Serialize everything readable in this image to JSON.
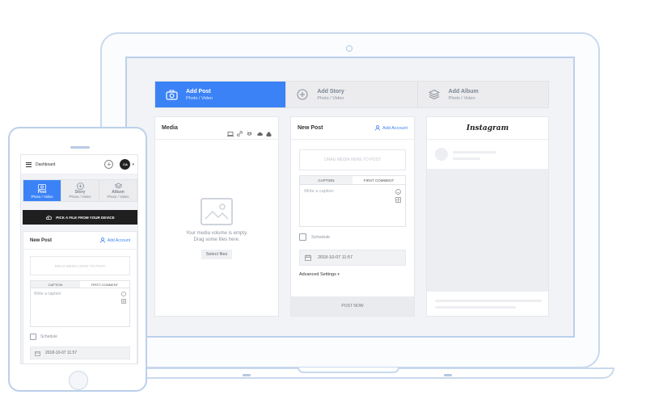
{
  "tabs": [
    {
      "title": "Add Post",
      "subtitle": "Photo / Video",
      "icon": "camera-icon"
    },
    {
      "title": "Add Story",
      "subtitle": "Photo / Video",
      "icon": "plus-circle-icon"
    },
    {
      "title": "Add Album",
      "subtitle": "Photo / Video",
      "icon": "layers-icon"
    }
  ],
  "media": {
    "title": "Media",
    "empty_line1": "Your media volume is empty.",
    "empty_line2": "Drag some files here.",
    "select_label": "Select files"
  },
  "new_post": {
    "title": "New Post",
    "add_account": "Add Account",
    "drop_placeholder": "DRAG MEDIA HERE TO POST",
    "tab_caption": "CAPTION",
    "tab_first_comment": "FIRST COMMENT",
    "caption_placeholder": "Write a caption",
    "schedule_label": "Schedule",
    "date_value": "2018-10-07 11:57",
    "advanced_label": "Advanced Settings",
    "post_now": "POST NOW"
  },
  "preview": {
    "logo": "Instagram"
  },
  "phone": {
    "header_title": "Dashboard",
    "avatar_initials": "CA",
    "tabs": [
      {
        "title": "Post",
        "subtitle": "Photo / Video"
      },
      {
        "title": "Story",
        "subtitle": "Photo / Video"
      },
      {
        "title": "Album",
        "subtitle": "Photo / Video"
      }
    ],
    "pick_file": "PICK A FILE FROM YOUR DEVICE",
    "new_post_title": "New Post",
    "add_account": "Add Account",
    "drop_placeholder": "DRAG MEDIA HERE TO POST",
    "tab_caption": "CAPTION",
    "tab_first_comment": "FIRST COMMENT",
    "caption_placeholder": "Write a caption",
    "schedule_label": "Schedule",
    "date_value": "2018-10-07 11:57"
  },
  "colors": {
    "accent": "#3b82f6",
    "device_outline": "#bcd0ea",
    "panel_bg": "#f2f3f6"
  }
}
